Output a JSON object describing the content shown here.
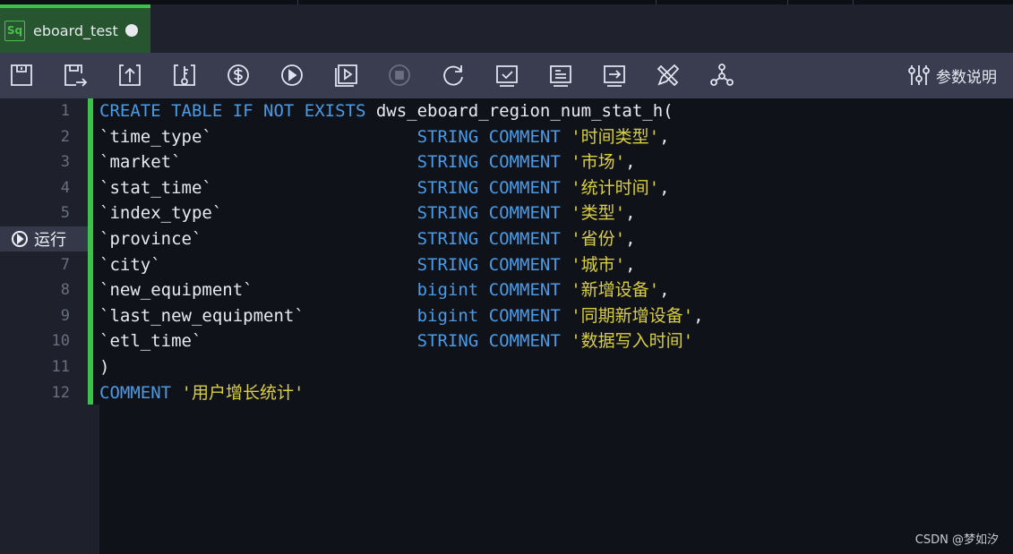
{
  "tab": {
    "icon_label": "Sq",
    "name": "eboard_test",
    "unsaved": true
  },
  "toolbar": {
    "buttons": [
      "save-icon",
      "save-as-icon",
      "upload-icon",
      "key-icon",
      "cost-icon",
      "run-icon",
      "run-selected-icon",
      "stop-icon",
      "refresh-icon",
      "check-icon",
      "format-icon",
      "export-icon",
      "edit-tools-icon",
      "lineage-icon"
    ],
    "params_label": "参数说明"
  },
  "gutter": {
    "run_label": "运行",
    "run_line": 6,
    "lines": [
      "1",
      "2",
      "3",
      "4",
      "5",
      "6",
      "7",
      "8",
      "9",
      "10",
      "11",
      "12"
    ]
  },
  "colors": {
    "keyword": "#4a9be6",
    "string": "#d9cf3c",
    "accent": "#3cc14c"
  },
  "code": [
    [
      {
        "t": "CREATE TABLE IF NOT EXISTS ",
        "c": "k"
      },
      {
        "t": "dws_eboard_region_num_stat_h(",
        "c": "p"
      }
    ],
    [
      {
        "t": "`time_type`                    ",
        "c": "p"
      },
      {
        "t": "STRING COMMENT ",
        "c": "k"
      },
      {
        "t": "'时间类型'",
        "c": "s"
      },
      {
        "t": ",",
        "c": "p"
      }
    ],
    [
      {
        "t": "`market`                       ",
        "c": "p"
      },
      {
        "t": "STRING COMMENT ",
        "c": "k"
      },
      {
        "t": "'市场'",
        "c": "s"
      },
      {
        "t": ",",
        "c": "p"
      }
    ],
    [
      {
        "t": "`stat_time`                    ",
        "c": "p"
      },
      {
        "t": "STRING COMMENT ",
        "c": "k"
      },
      {
        "t": "'统计时间'",
        "c": "s"
      },
      {
        "t": ",",
        "c": "p"
      }
    ],
    [
      {
        "t": "`index_type`                   ",
        "c": "p"
      },
      {
        "t": "STRING COMMENT ",
        "c": "k"
      },
      {
        "t": "'类型'",
        "c": "s"
      },
      {
        "t": ",",
        "c": "p"
      }
    ],
    [
      {
        "t": "`province`                     ",
        "c": "p"
      },
      {
        "t": "STRING COMMENT ",
        "c": "k"
      },
      {
        "t": "'省份'",
        "c": "s"
      },
      {
        "t": ",",
        "c": "p"
      }
    ],
    [
      {
        "t": "`city`                         ",
        "c": "p"
      },
      {
        "t": "STRING COMMENT ",
        "c": "k"
      },
      {
        "t": "'城市'",
        "c": "s"
      },
      {
        "t": ",",
        "c": "p"
      }
    ],
    [
      {
        "t": "`new_equipment`                ",
        "c": "p"
      },
      {
        "t": "bigint COMMENT ",
        "c": "k"
      },
      {
        "t": "'新增设备'",
        "c": "s"
      },
      {
        "t": ",",
        "c": "p"
      }
    ],
    [
      {
        "t": "`last_new_equipment`           ",
        "c": "p"
      },
      {
        "t": "bigint COMMENT ",
        "c": "k"
      },
      {
        "t": "'同期新增设备'",
        "c": "s"
      },
      {
        "t": ",",
        "c": "p"
      }
    ],
    [
      {
        "t": "`etl_time`                     ",
        "c": "p"
      },
      {
        "t": "STRING COMMENT ",
        "c": "k"
      },
      {
        "t": "'数据写入时间'",
        "c": "s"
      }
    ],
    [
      {
        "t": ")",
        "c": "p"
      }
    ],
    [
      {
        "t": "COMMENT ",
        "c": "k"
      },
      {
        "t": "'用户增长统计'",
        "c": "s"
      }
    ]
  ],
  "watermark": "CSDN @梦如汐"
}
